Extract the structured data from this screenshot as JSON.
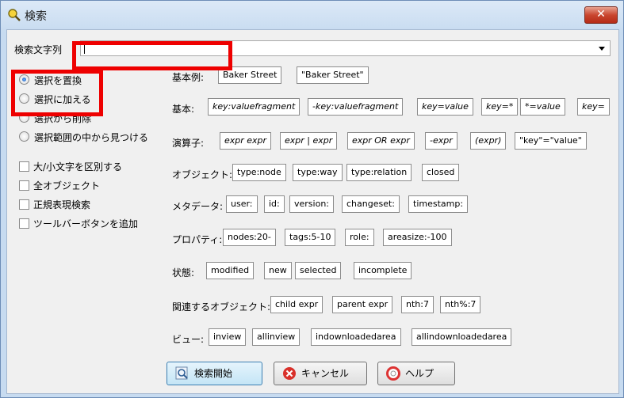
{
  "window": {
    "title": "検索",
    "close_label": "✕"
  },
  "search": {
    "label": "検索文字列",
    "value": ""
  },
  "modes": [
    "選択を置換",
    "選択に加える",
    "選択から削除",
    "選択範囲の中から見つける"
  ],
  "options": [
    "大/小文字を区別する",
    "全オブジェクト",
    "正規表現検索",
    "ツールバーボタンを追加"
  ],
  "sections": {
    "basic_example": {
      "label": "基本例:",
      "chips": [
        "Baker Street",
        "\"Baker Street\""
      ]
    },
    "basic": {
      "label": "基本:",
      "chips": [
        "key:valuefragment",
        "-key:valuefragment",
        "key=value",
        "key=*",
        "*=value",
        "key="
      ]
    },
    "operators": {
      "label": "演算子:",
      "chips": [
        "expr expr",
        "expr | expr",
        "expr OR expr",
        "-expr",
        "(expr)",
        "\"key\"=\"value\""
      ]
    },
    "objects": {
      "label": "オブジェクト:",
      "chips": [
        "type:node",
        "type:way",
        "type:relation",
        "closed"
      ]
    },
    "metadata": {
      "label": "メタデータ:",
      "chips": [
        "user:",
        "id:",
        "version:",
        "changeset:",
        "timestamp:"
      ]
    },
    "properties": {
      "label": "プロパティ:",
      "chips": [
        "nodes:20-",
        "tags:5-10",
        "role:",
        "areasize:-100"
      ]
    },
    "state": {
      "label": "状態:",
      "chips": [
        "modified",
        "new",
        "selected",
        "incomplete"
      ]
    },
    "related": {
      "label": "関連するオブジェクト:",
      "chips": [
        "child expr",
        "parent expr",
        "nth:7",
        "nth%:7"
      ]
    },
    "view": {
      "label": "ビュー:",
      "chips": [
        "inview",
        "allinview",
        "indownloadedarea",
        "allindownloadedarea"
      ]
    }
  },
  "buttons": {
    "search": "検索開始",
    "cancel": "キャンセル",
    "help": "ヘルプ"
  },
  "colors": {
    "highlight": "#ee0000",
    "primary_button": "#c4e5f6"
  }
}
